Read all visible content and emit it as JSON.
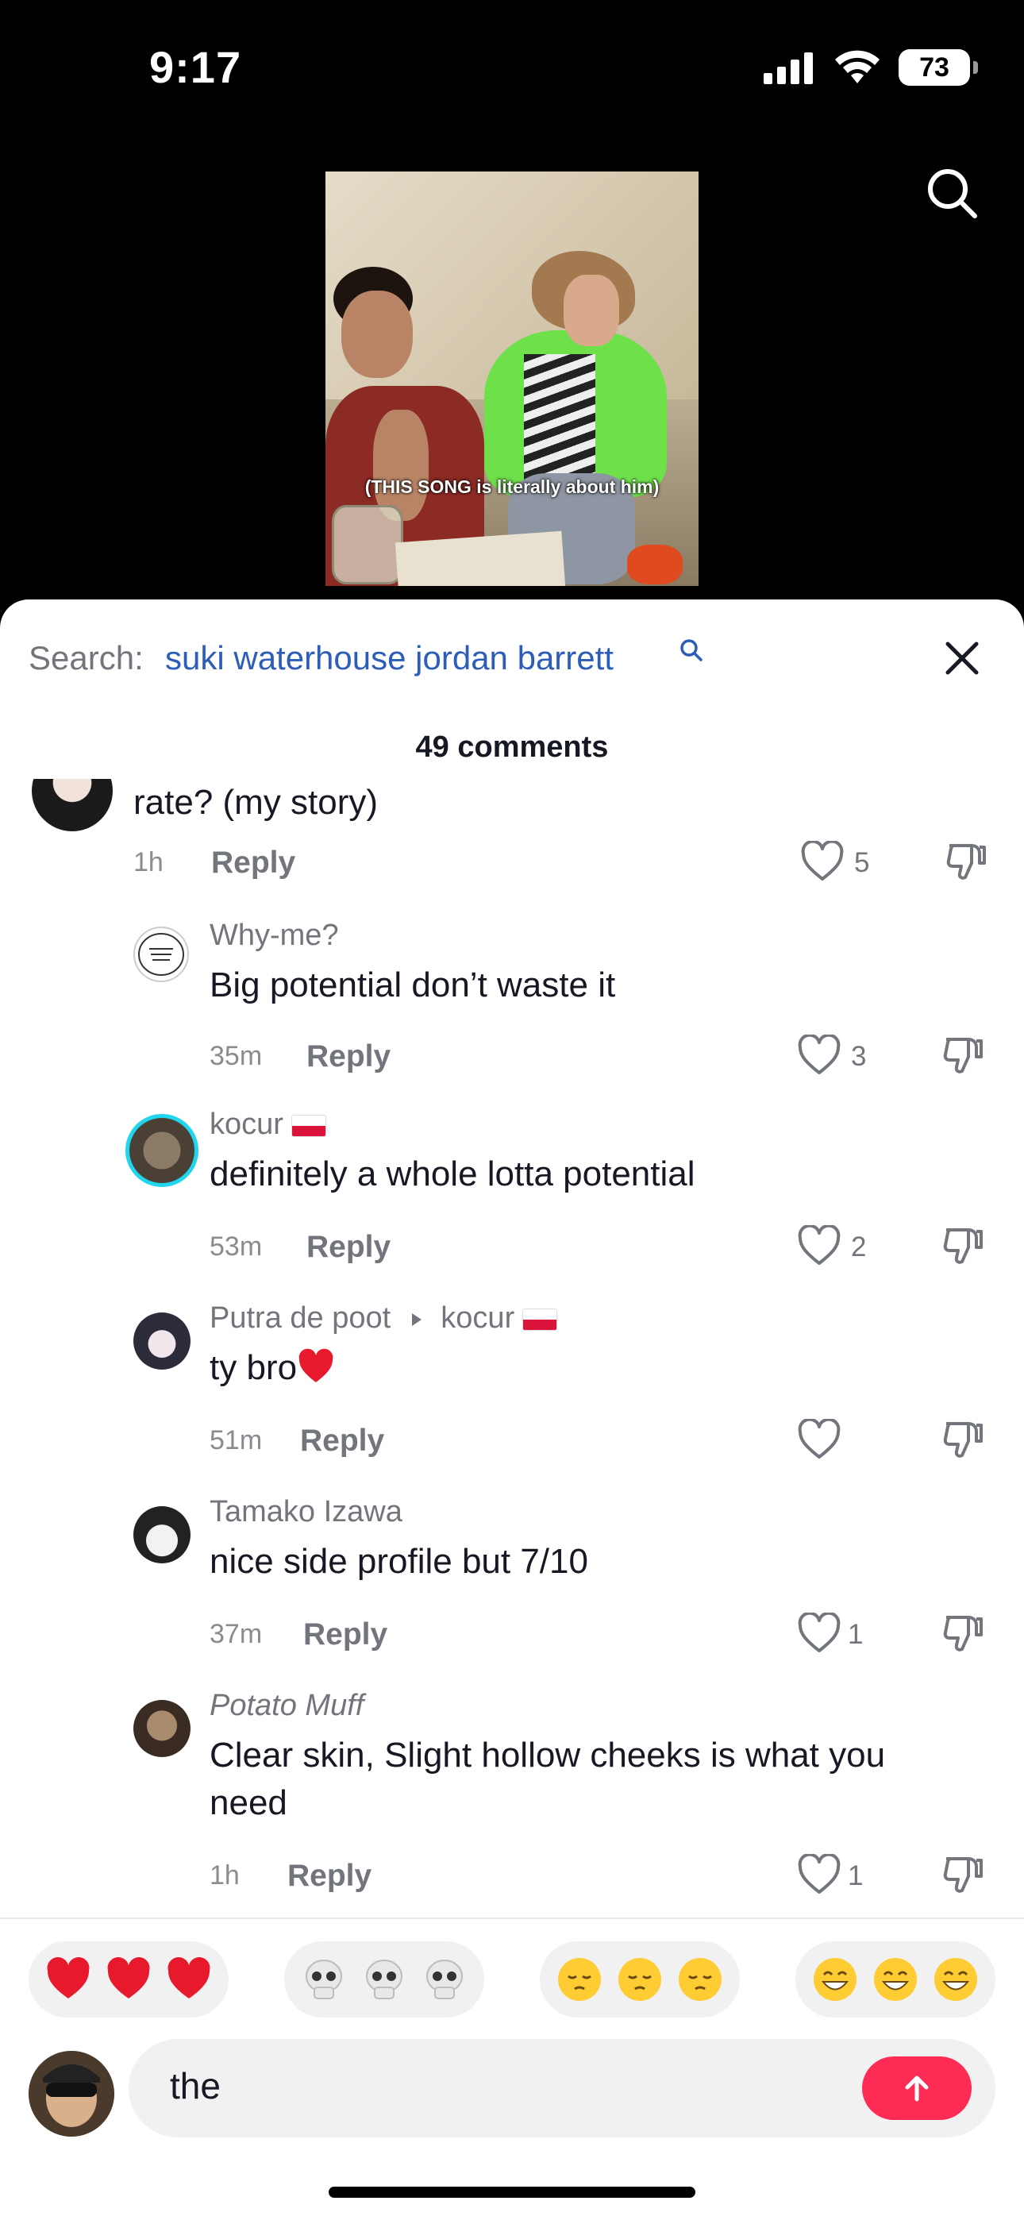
{
  "status_bar": {
    "time": "9:17",
    "battery": "73"
  },
  "video": {
    "caption": "(THIS SONG is literally about him)"
  },
  "search": {
    "prefix": "Search:",
    "query": "suki waterhouse jordan barrett"
  },
  "comments_header": {
    "count_label": "49 comments"
  },
  "comments": [
    {
      "username": "",
      "text": "rate? (my story)",
      "time": "1h",
      "reply_label": "Reply",
      "likes": "5"
    },
    {
      "username": "Why-me?",
      "text": "Big potential don’t waste it",
      "time": "35m",
      "reply_label": "Reply",
      "likes": "3"
    },
    {
      "username": "kocur",
      "text": "definitely a whole lotta potential",
      "time": "53m",
      "reply_label": "Reply",
      "likes": "2"
    },
    {
      "username": "Putra de poot",
      "reply_to": "kocur",
      "text": "ty bro",
      "time": "51m",
      "reply_label": "Reply",
      "likes": ""
    },
    {
      "username": "Tamako Izawa",
      "text": "nice side profile but 7/10",
      "time": "37m",
      "reply_label": "Reply",
      "likes": "1"
    },
    {
      "username": "Potato Muff",
      "text": "Clear skin, Slight hollow cheeks is what you need",
      "time": "1h",
      "reply_label": "Reply",
      "likes": "1"
    }
  ],
  "quick_emojis": [
    "heart-eyes... red hearts",
    "skulls",
    "pensive faces",
    "grinning faces"
  ],
  "input": {
    "value": "the"
  },
  "colors": {
    "accent": "#fe2c55",
    "link": "#2b5db9",
    "muted": "#73757c"
  }
}
